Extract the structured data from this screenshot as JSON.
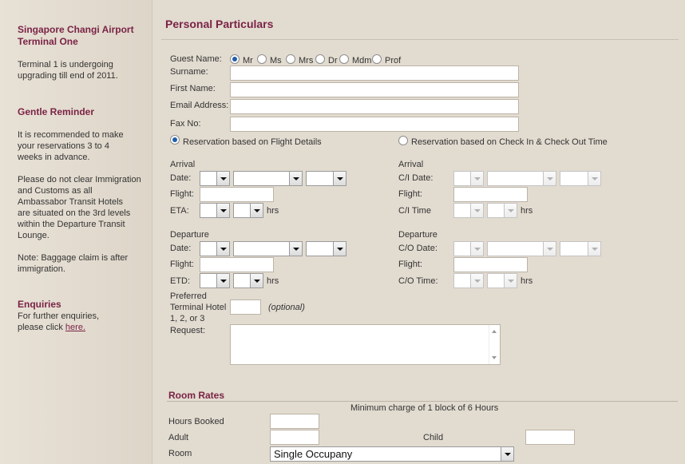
{
  "sidebar": {
    "terminal_title_1": "Singapore Changi Airport",
    "terminal_title_2": "Terminal One",
    "terminal_note_1": "Terminal 1 is undergoing",
    "terminal_note_2": "upgrading till end of 2011.",
    "reminder_title": "Gentle Reminder",
    "reminder_1": [
      "It is recommended to make",
      "your reservations 3 to 4",
      "weeks in advance."
    ],
    "reminder_2": [
      "Please do not clear Immigration",
      "and Customs as all",
      "Ambassabor Transit Hotels",
      "are situated on the 3rd levels",
      "within the Departure Transit",
      "Lounge."
    ],
    "reminder_3": [
      "Note: Baggage claim is after",
      "immigration."
    ],
    "enquiries_title": "Enquiries",
    "enquiries_line_1": "For further enquiries,",
    "enquiries_line_2": "please click ",
    "enquiries_link": "here."
  },
  "main": {
    "title": "Personal Particulars",
    "guest_name_label": "Guest Name:",
    "titles": [
      {
        "label": "Mr",
        "selected": true
      },
      {
        "label": "Ms",
        "selected": false
      },
      {
        "label": "Mrs",
        "selected": false
      },
      {
        "label": "Dr",
        "selected": false
      },
      {
        "label": "Mdm",
        "selected": false
      },
      {
        "label": "Prof",
        "selected": false
      }
    ],
    "surname_label": "Surname:",
    "first_name_label": "First Name:",
    "email_label": "Email Address:",
    "fax_label": "Fax No:",
    "reservation_flight_label": "Reservation based on Flight Details",
    "reservation_checkin_label": "Reservation based on Check In & Check Out Time",
    "arrival_label": "Arrival",
    "date_label": "Date:",
    "flight_label": "Flight:",
    "eta_label": "ETA:",
    "hrs_label": "hrs",
    "ci_arrival_label": "Arrival",
    "ci_date_label": "C/I Date:",
    "ci_flight_label": "Flight:",
    "ci_time_label": "C/I Time",
    "departure_label": "Departure",
    "etd_label": "ETD:",
    "co_departure_label": "Departure",
    "co_date_label": "C/O Date:",
    "co_flight_label": "Flight:",
    "co_time_label": "C/O Time:",
    "preferred_label_1": "Preferred",
    "preferred_label_2": "Terminal Hotel",
    "preferred_label_3": "1, 2, or 3",
    "optional_label": "(optional)",
    "request_label": "Request:"
  },
  "rates": {
    "title": "Room Rates",
    "min_charge": "Minimum charge of 1 block of 6 Hours",
    "hours_booked_label": "Hours Booked",
    "adult_label": "Adult",
    "child_label": "Child",
    "room_label": "Room",
    "room_value": "Single Occupany"
  }
}
